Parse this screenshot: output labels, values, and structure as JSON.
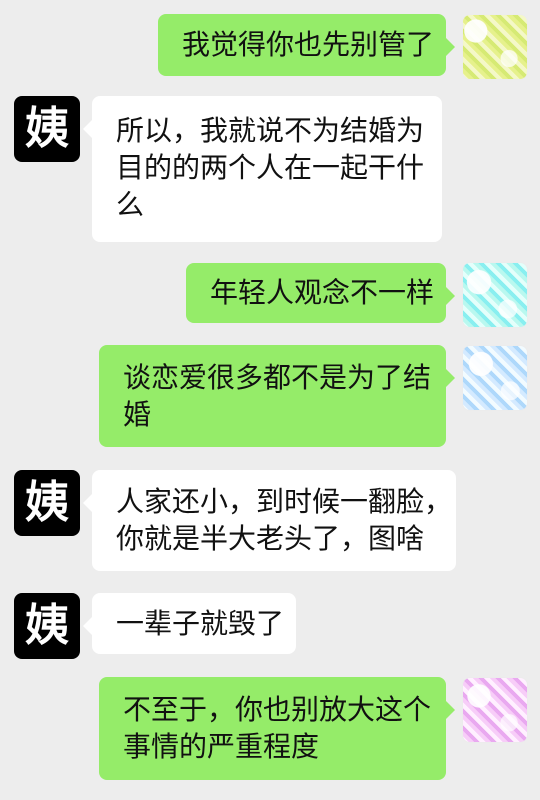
{
  "left_avatar_label": "姨",
  "messages": [
    {
      "lines": [
        "我觉得你也先别管了"
      ]
    },
    {
      "lines": [
        "所以，我就说不为结婚为",
        "目的的两个人在一起干什",
        "么"
      ]
    },
    {
      "lines": [
        "年轻人观念不一样"
      ]
    },
    {
      "lines": [
        "谈恋爱很多都不是为了结",
        "婚"
      ]
    },
    {
      "lines": [
        "人家还小，到时候一翻脸，",
        "你就是半大老头了，图啥"
      ]
    },
    {
      "lines": [
        "一辈子就毁了"
      ]
    },
    {
      "lines": [
        "不至于，你也别放大这个",
        "事情的严重程度"
      ]
    }
  ]
}
